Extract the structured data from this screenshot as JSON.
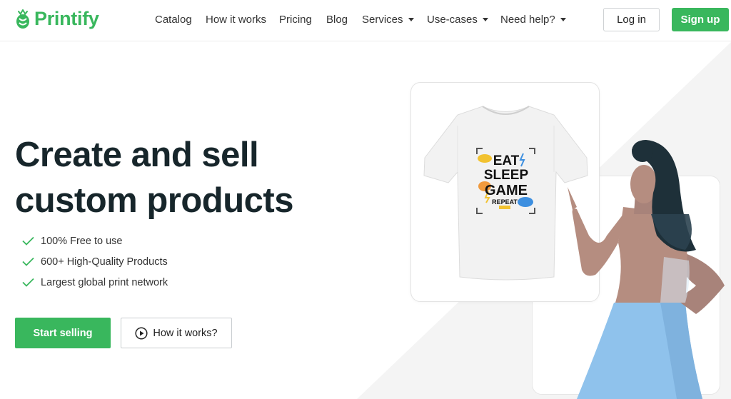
{
  "header": {
    "brand": "Printify",
    "nav": [
      {
        "label": "Catalog",
        "dropdown": false
      },
      {
        "label": "How it works",
        "dropdown": false
      },
      {
        "label": "Pricing",
        "dropdown": false
      },
      {
        "label": "Blog",
        "dropdown": false
      },
      {
        "label": "Services",
        "dropdown": true
      },
      {
        "label": "Use-cases",
        "dropdown": true
      },
      {
        "label": "Need help?",
        "dropdown": true
      }
    ],
    "login_label": "Log in",
    "signup_label": "Sign up"
  },
  "hero": {
    "title_line1": "Create and sell",
    "title_line2": "custom products",
    "features": [
      "100% Free to use",
      "600+ High-Quality Products",
      "Largest global print network"
    ],
    "primary_cta": "Start selling",
    "secondary_cta": "How it works?"
  },
  "tshirt_print": {
    "line1": "EAT",
    "line2": "SLEEP",
    "line3": "GAME",
    "line4": "REPEAT"
  },
  "colors": {
    "brand_green": "#39b75d",
    "title_dark": "#17262b",
    "skirt_blue": "#8fc2ec",
    "hair": "#1e3039",
    "skin": "#b58d80"
  },
  "icons": {
    "logo": "printify-pineapple-icon",
    "feature": "check-icon",
    "secondary_cta": "play-circle-icon",
    "nav_dropdown": "caret-down-icon"
  }
}
